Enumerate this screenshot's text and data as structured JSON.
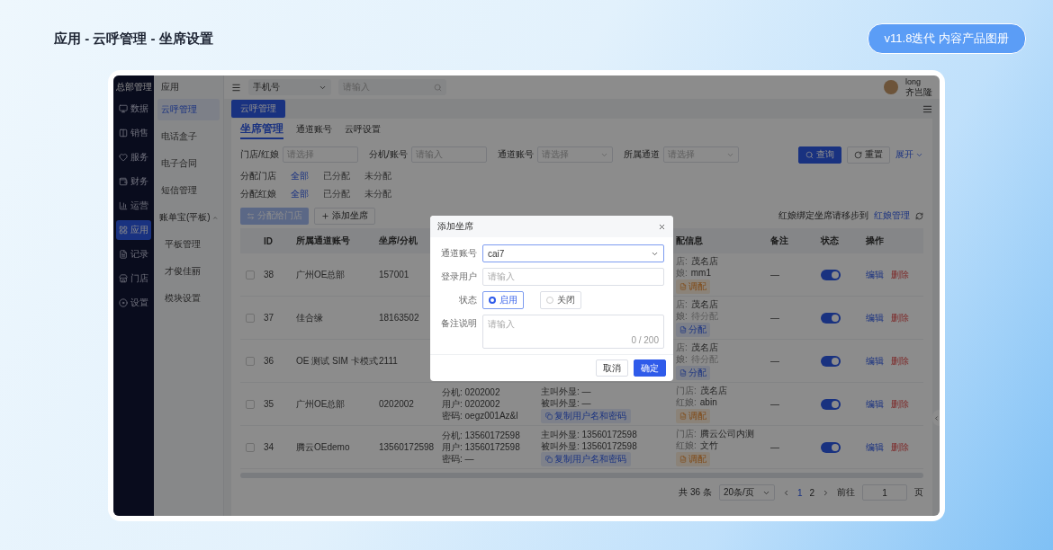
{
  "page": {
    "title": "应用 - 云呼管理 - 坐席设置",
    "badge": "v11.8迭代 内容产品图册"
  },
  "nav": {
    "brand": "总部管理",
    "items": [
      {
        "label": "数据",
        "selected": false
      },
      {
        "label": "销售",
        "selected": false
      },
      {
        "label": "服务",
        "selected": false
      },
      {
        "label": "财务",
        "selected": false
      },
      {
        "label": "运营",
        "selected": false
      },
      {
        "label": "应用",
        "selected": true
      },
      {
        "label": "记录",
        "selected": false
      },
      {
        "label": "门店",
        "selected": false
      },
      {
        "label": "设置",
        "selected": false
      }
    ]
  },
  "subnav": {
    "title": "应用",
    "items": [
      {
        "label": "云呼管理",
        "selected": true
      },
      {
        "label": "电话盒子",
        "selected": false
      },
      {
        "label": "电子合同",
        "selected": false
      },
      {
        "label": "短信管理",
        "selected": false
      }
    ],
    "group": {
      "label": "账单宝(平板)",
      "expanded": true,
      "children": [
        {
          "label": "平板管理",
          "selected": false
        },
        {
          "label": "才俊佳丽",
          "selected": false
        },
        {
          "label": "模块设置",
          "selected": false
        }
      ]
    }
  },
  "topbar": {
    "select": {
      "value": "手机号"
    },
    "search": {
      "placeholder": "请输入"
    },
    "user": {
      "name": "long",
      "role": "齐岂隆"
    }
  },
  "page_tabs": [
    {
      "label": "云呼管理",
      "selected": true
    }
  ],
  "tabs": [
    {
      "label": "坐席管理",
      "selected": true
    },
    {
      "label": "通道账号",
      "selected": false
    },
    {
      "label": "云呼设置",
      "selected": false
    }
  ],
  "filters": [
    {
      "label": "门店/红娘",
      "kind": "input",
      "placeholder": "请选择"
    },
    {
      "label": "分机/账号",
      "kind": "input",
      "placeholder": "请输入"
    },
    {
      "label": "通道账号",
      "kind": "select",
      "placeholder": "请选择"
    },
    {
      "label": "所属通道",
      "kind": "select",
      "placeholder": "请选择"
    }
  ],
  "filter_actions": {
    "search": "查询",
    "reset": "重置",
    "expand": "展开"
  },
  "segments": [
    {
      "label": "分配门店",
      "options": [
        {
          "label": "全部",
          "selected": true
        },
        {
          "label": "已分配",
          "selected": false
        },
        {
          "label": "未分配",
          "selected": false
        }
      ]
    },
    {
      "label": "分配红娘",
      "options": [
        {
          "label": "全部",
          "selected": true
        },
        {
          "label": "已分配",
          "selected": false
        },
        {
          "label": "未分配",
          "selected": false
        }
      ]
    }
  ],
  "toolbar": {
    "assign": {
      "label": "分配给门店",
      "disabled": true
    },
    "add": "添加坐席",
    "hint": "红娘绑定坐席请移步到",
    "link": "红娘管理"
  },
  "table": {
    "columns": [
      "ID",
      "所属通道账号",
      "坐席/分机",
      "配信息",
      "备注",
      "状态",
      "操作"
    ],
    "rows": [
      {
        "checked": false,
        "id": "38",
        "channel": "广州OE总部",
        "seat": "157001",
        "store_label": "店:",
        "store": "茂名店",
        "mm_label": "娘:",
        "mm": "mm1",
        "mm_pending": false,
        "tag": {
          "label": "调配",
          "kind": "reassign"
        },
        "remark": "—",
        "on": true,
        "edit": "编辑",
        "delete": "删除"
      },
      {
        "checked": false,
        "id": "37",
        "channel": "佳合缘",
        "seat": "18163502",
        "store_label": "店:",
        "store": "茂名店",
        "mm_label": "娘:",
        "mm": "待分配",
        "mm_pending": true,
        "tag": {
          "label": "分配",
          "kind": "assign"
        },
        "remark": "—",
        "on": true,
        "edit": "编辑",
        "delete": "删除"
      },
      {
        "checked": false,
        "id": "36",
        "channel": "OE 测试 SIM 卡模式",
        "seat": "2111",
        "store_label": "店:",
        "store": "茂名店",
        "mm_label": "娘:",
        "mm": "待分配",
        "mm_pending": true,
        "tag": {
          "label": "分配",
          "kind": "assign"
        },
        "remark": "—",
        "on": true,
        "edit": "编辑",
        "delete": "删除"
      },
      {
        "checked": false,
        "id": "35",
        "channel": "广州OE总部",
        "seat": "0202002",
        "ext": [
          "分机: 0202002",
          "用户: 0202002",
          "密码: oegz001Az&l"
        ],
        "display": [
          "主叫外显: —",
          "被叫外显: —"
        ],
        "copy": "复制用户名和密码",
        "store_label": "门店:",
        "store": "茂名店",
        "mm_label": "红娘:",
        "mm": "abin",
        "mm_pending": false,
        "tag": {
          "label": "调配",
          "kind": "reassign"
        },
        "remark": "—",
        "on": true,
        "edit": "编辑",
        "delete": "删除"
      },
      {
        "checked": false,
        "id": "34",
        "channel": "腾云OEdemo",
        "seat": "13560172598",
        "ext": [
          "分机: 13560172598",
          "用户: 13560172598",
          "密码: —"
        ],
        "display": [
          "主叫外显: 13560172598",
          "被叫外显: 13560172598"
        ],
        "copy": "复制用户名和密码",
        "store_label": "门店:",
        "store": "腾云公司内测",
        "mm_label": "红娘:",
        "mm": "文竹",
        "mm_pending": false,
        "tag": {
          "label": "调配",
          "kind": "reassign"
        },
        "remark": "—",
        "on": true,
        "edit": "编辑",
        "delete": "删除"
      }
    ]
  },
  "pagination": {
    "total": "共 36 条",
    "page_size": "20条/页",
    "pages": [
      {
        "label": "1",
        "selected": true
      },
      {
        "label": "2",
        "selected": false
      }
    ],
    "goto": "前往",
    "goto_value": "1",
    "unit": "页"
  },
  "dialog": {
    "title": "添加坐席",
    "fields": [
      {
        "label": "通道账号",
        "kind": "select",
        "value": "cai7"
      },
      {
        "label": "登录用户",
        "kind": "input",
        "placeholder": "请输入"
      },
      {
        "label": "状态",
        "kind": "radio",
        "options": [
          {
            "label": "启用",
            "selected": true
          },
          {
            "label": "关闭",
            "selected": false
          }
        ]
      },
      {
        "label": "备注说明",
        "kind": "textarea",
        "placeholder": "请输入",
        "counter": "0 / 200"
      }
    ],
    "cancel": "取消",
    "confirm": "确定"
  }
}
